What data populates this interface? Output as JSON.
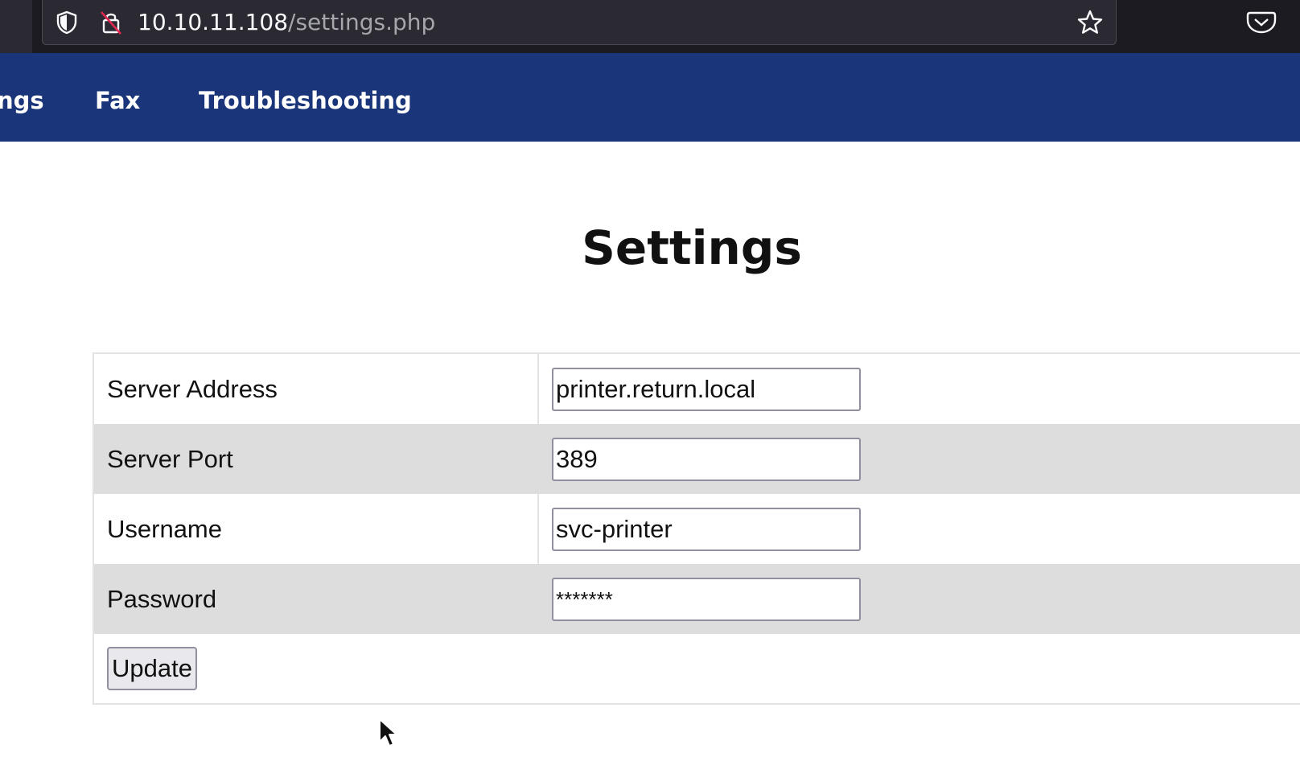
{
  "browser": {
    "url_host": "10.10.11.108",
    "url_path": "/settings.php"
  },
  "nav": {
    "items": [
      {
        "label": "ngs"
      },
      {
        "label": "Fax"
      },
      {
        "label": "Troubleshooting"
      }
    ]
  },
  "page": {
    "title": "Settings"
  },
  "form": {
    "fields": [
      {
        "label": "Server Address",
        "value": "printer.return.local"
      },
      {
        "label": "Server Port",
        "value": "389"
      },
      {
        "label": "Username",
        "value": "svc-printer"
      },
      {
        "label": "Password",
        "value": "*******"
      }
    ],
    "submit_label": "Update"
  },
  "icons": {
    "shield": "shield-icon",
    "lock": "insecure-lock-icon",
    "star": "bookmark-star-icon",
    "pocket": "pocket-icon",
    "cursor": "mouse-cursor-icon"
  },
  "colors": {
    "navbar": "#1a357a",
    "browser_chrome": "#1c1b22",
    "alt_row": "#dddddd"
  }
}
